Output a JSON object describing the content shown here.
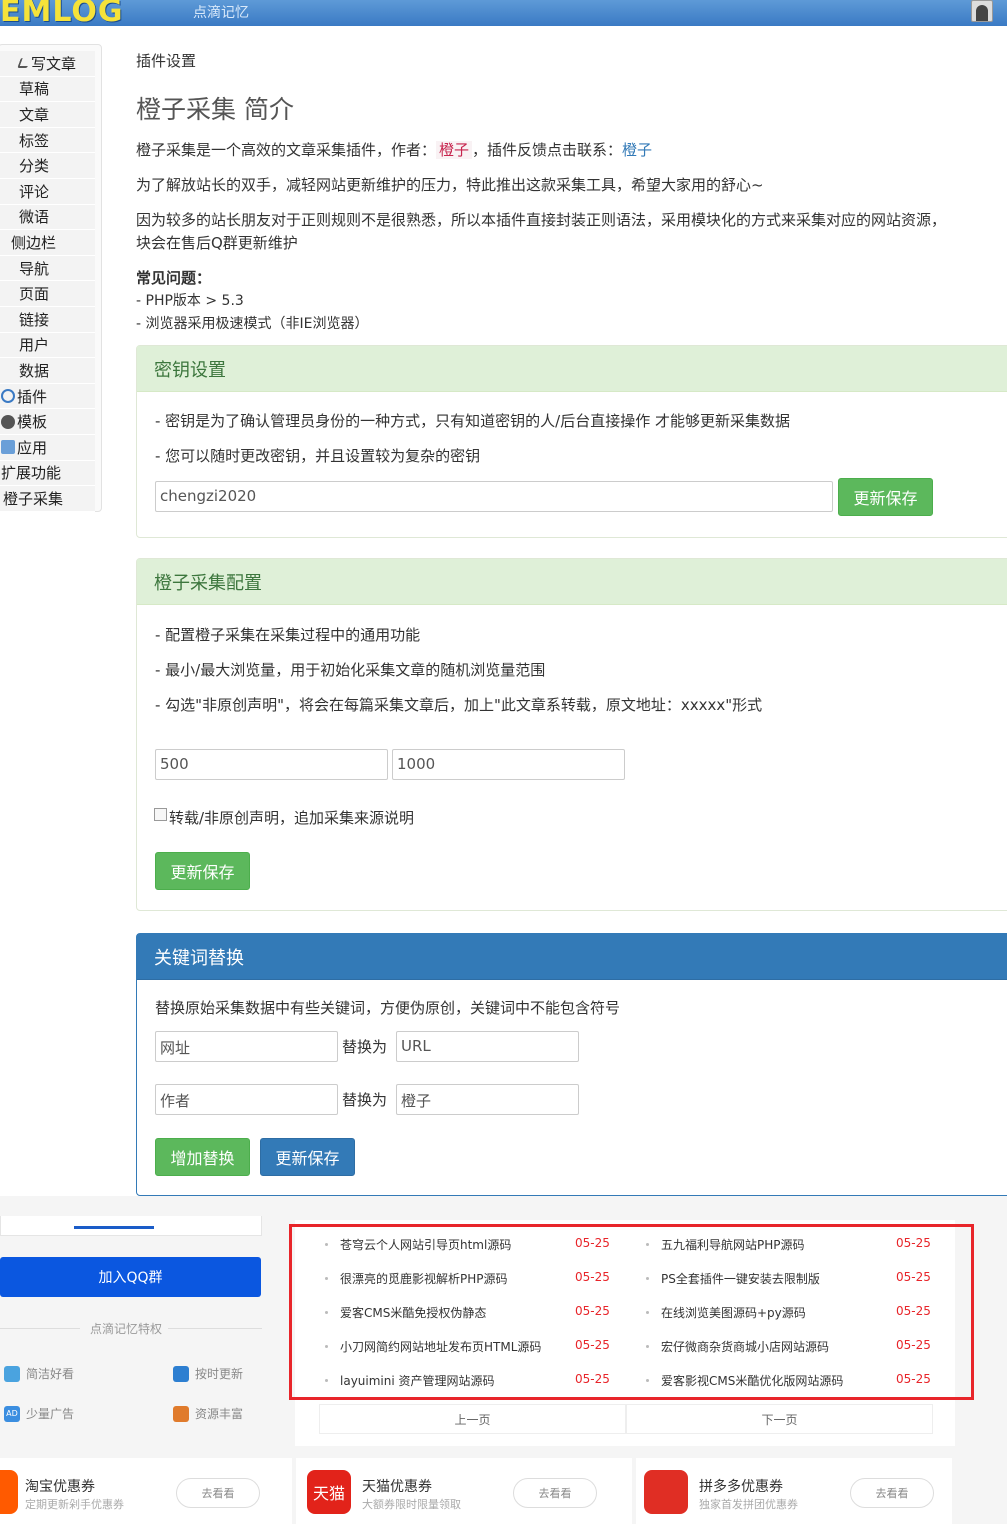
{
  "header": {
    "logo": "EMLOG",
    "site_name": "点滴记忆"
  },
  "sidebar": {
    "items": [
      {
        "label": "写文章"
      },
      {
        "label": "草稿"
      },
      {
        "label": "文章"
      },
      {
        "label": "标签"
      },
      {
        "label": "分类"
      },
      {
        "label": "评论"
      },
      {
        "label": "微语"
      },
      {
        "label": "侧边栏"
      },
      {
        "label": "导航"
      },
      {
        "label": "页面"
      },
      {
        "label": "链接"
      },
      {
        "label": "用户"
      },
      {
        "label": "数据"
      },
      {
        "label": "插件"
      },
      {
        "label": "模板"
      },
      {
        "label": "应用"
      },
      {
        "label": "扩展功能"
      },
      {
        "label": "橙子采集"
      }
    ]
  },
  "main": {
    "breadcrumb": "插件设置",
    "title": "橙子采集 简介",
    "intro1_a": "橙子采集是一个高效的文章采集插件，作者：",
    "intro1_author": "橙子",
    "intro1_b": "，插件反馈点击联系：",
    "intro1_link": "橙子",
    "intro2": "为了解放站长的双手，减轻网站更新维护的压力，特此推出这款采集工具，希望大家用的舒心~",
    "intro3_line1": "因为较多的站长朋友对于正则规则不是很熟悉，所以本插件直接封装正则语法，采用模块化的方式来采集对应的网站资源，",
    "intro3_line2": "块会在售后Q群更新维护",
    "faq_title": "常见问题：",
    "faq1": "- PHP版本 > 5.3",
    "faq2": "- 浏览器采用极速模式（非IE浏览器）"
  },
  "key_panel": {
    "title": "密钥设置",
    "line1": "- 密钥是为了确认管理员身份的一种方式，只有知道密钥的人/后台直接操作 才能够更新采集数据",
    "line2": "- 您可以随时更改密钥，并且设置较为复杂的密钥",
    "key_value": "chengzi2020",
    "save_label": "更新保存"
  },
  "config_panel": {
    "title": "橙子采集配置",
    "line1": "- 配置橙子采集在采集过程中的通用功能",
    "line2": "- 最小/最大浏览量，用于初始化采集文章的随机浏览量范围",
    "line3": "- 勾选\"非原创声明\"，将会在每篇采集文章后，加上\"此文章系转载，原文地址：xxxxx\"形式",
    "min_views": "500",
    "max_views": "1000",
    "checkbox_label": "转载/非原创声明，追加采集来源说明",
    "save_label": "更新保存"
  },
  "replace_panel": {
    "title": "关键词替换",
    "desc": "替换原始采集数据中有些关键词，方便伪原创，关键词中不能包含符号",
    "rows": [
      {
        "from": "网址",
        "to_label": "替换为",
        "to": "URL"
      },
      {
        "from": "作者",
        "to_label": "替换为",
        "to": "橙子"
      }
    ],
    "add_label": "增加替换",
    "save_label": "更新保存"
  },
  "lower": {
    "qq_label": "加入QQ群",
    "privilege_title": "点滴记忆特权",
    "features": [
      "简洁好看",
      "按时更新",
      "少量广告",
      "资源丰富"
    ],
    "feature_badge": "AD",
    "list_left": [
      {
        "title": "苍穹云个人网站引导页html源码",
        "date": "05-25"
      },
      {
        "title": "很漂亮的觅鹿影视解析PHP源码",
        "date": "05-25"
      },
      {
        "title": "爱客CMS米酷免授权伪静态",
        "date": "05-25"
      },
      {
        "title": "小刀网简约网站地址发布页HTML源码",
        "date": "05-25"
      },
      {
        "title": "layuimini 资产管理网站源码",
        "date": "05-25"
      }
    ],
    "list_right": [
      {
        "title": "五九福利导航网站PHP源码",
        "date": "05-25"
      },
      {
        "title": "PS全套插件一键安装去限制版",
        "date": "05-25"
      },
      {
        "title": "在线浏览美图源码+py源码",
        "date": "05-25"
      },
      {
        "title": "宏仔微商杂货商城小店网站源码",
        "date": "05-25"
      },
      {
        "title": "爱客影视CMS米酷优化版网站源码",
        "date": "05-25"
      }
    ],
    "prev_label": "上一页",
    "next_label": "下一页",
    "coupons": [
      {
        "title": "淘宝优惠券",
        "sub": "定期更新剁手优惠券",
        "btn": "去看看",
        "icon_text": ""
      },
      {
        "title": "天猫优惠券",
        "sub": "大额券限时限量领取",
        "btn": "去看看",
        "icon_text": "天猫"
      },
      {
        "title": "拼多多优惠券",
        "sub": "独家首发拼团优惠券",
        "btn": "去看看",
        "icon_text": ""
      }
    ]
  }
}
